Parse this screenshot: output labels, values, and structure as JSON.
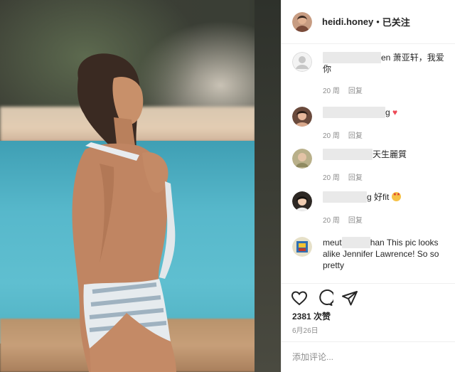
{
  "post": {
    "username": "heidi.honey",
    "separator": "•",
    "follow_status": "已关注",
    "likes": "2381 次赞",
    "date": "6月26日"
  },
  "comments": [
    {
      "name_visible": "en",
      "text": "萧亚轩，我爱你",
      "time": "20 周",
      "reply": "回复"
    },
    {
      "name_visible": "g",
      "text": "",
      "emoji": "red-heart",
      "time": "20 周",
      "reply": "回复"
    },
    {
      "name_visible": "天生麗質",
      "text": "",
      "time": "20 周",
      "reply": "回复"
    },
    {
      "name_visible": "g",
      "text": "好fit",
      "emoji": "star-struck-face",
      "time": "20 周",
      "reply": "回复"
    },
    {
      "name_visible": "meut",
      "name_suffix": "han",
      "text": "This pic looks alike Jennifer Lawrence! So so pretty",
      "time": "",
      "reply": ""
    }
  ],
  "composer": {
    "placeholder": "添加评论..."
  },
  "icons": {
    "like": "heart-outline-icon",
    "comment": "speech-bubble-icon",
    "share": "paper-plane-icon"
  },
  "colors": {
    "highlight": "#d62d25",
    "heart": "#ed4956",
    "meta_text": "#8e8e8e"
  }
}
